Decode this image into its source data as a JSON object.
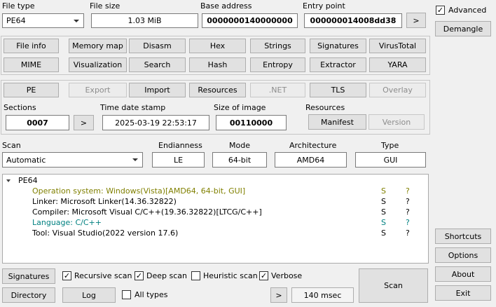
{
  "header": {
    "file_type_label": "File type",
    "file_type_value": "PE64",
    "file_size_label": "File size",
    "file_size_value": "1.03 MiB",
    "base_address_label": "Base address",
    "base_address_value": "0000000140000000",
    "entry_point_label": "Entry point",
    "entry_point_value": "000000014008dd38",
    "entry_point_go": ">"
  },
  "right_panel": {
    "advanced_label": "Advanced",
    "advanced_checked": true,
    "demangle": "Demangle",
    "shortcuts": "Shortcuts",
    "options": "Options",
    "about": "About",
    "exit": "Exit"
  },
  "tools_row1": [
    "File info",
    "Memory map",
    "Disasm",
    "Hex",
    "Strings",
    "Signatures",
    "VirusTotal"
  ],
  "tools_row2": [
    "MIME",
    "Visualization",
    "Search",
    "Hash",
    "Entropy",
    "Extractor",
    "YARA"
  ],
  "pe_row": {
    "pe": "PE",
    "export": "Export",
    "import": "Import",
    "resources": "Resources",
    "net": ".NET",
    "tls": "TLS",
    "overlay": "Overlay"
  },
  "pe_info": {
    "sections_label": "Sections",
    "sections_value": "0007",
    "sections_go": ">",
    "timestamp_label": "Time date stamp",
    "timestamp_value": "2025-03-19 22:53:17",
    "size_label": "Size of image",
    "size_value": "00110000",
    "resources_label": "Resources",
    "manifest": "Manifest",
    "version": "Version"
  },
  "scan": {
    "scan_label": "Scan",
    "scan_value": "Automatic",
    "endianness_label": "Endianness",
    "endianness_value": "LE",
    "mode_label": "Mode",
    "mode_value": "64-bit",
    "architecture_label": "Architecture",
    "architecture_value": "AMD64",
    "type_label": "Type",
    "type_value": "GUI"
  },
  "results": {
    "root": "PE64",
    "items": [
      {
        "text": "Operation system: Windows(Vista)[AMD64, 64-bit, GUI]",
        "flag": "S",
        "q": "?",
        "color": "#808000"
      },
      {
        "text": "Linker: Microsoft Linker(14.36.32822)",
        "flag": "S",
        "q": "?",
        "color": "#000000"
      },
      {
        "text": "Compiler: Microsoft Visual C/C++(19.36.32822)[LTCG/C++]",
        "flag": "S",
        "q": "?",
        "color": "#000000"
      },
      {
        "text": "Language: C/C++",
        "flag": "S",
        "q": "?",
        "color": "#008080"
      },
      {
        "text": "Tool: Visual Studio(2022 version 17.6)",
        "flag": "S",
        "q": "?",
        "color": "#000000"
      }
    ]
  },
  "bottom": {
    "signatures": "Signatures",
    "recursive": "Recursive scan",
    "recursive_checked": true,
    "deep": "Deep scan",
    "deep_checked": true,
    "heuristic": "Heuristic scan",
    "heuristic_checked": false,
    "verbose": "Verbose",
    "verbose_checked": true,
    "directory": "Directory",
    "log": "Log",
    "all_types": "All types",
    "all_types_checked": false,
    "go": ">",
    "time": "140 msec",
    "scan": "Scan"
  },
  "check_mark": "✓"
}
